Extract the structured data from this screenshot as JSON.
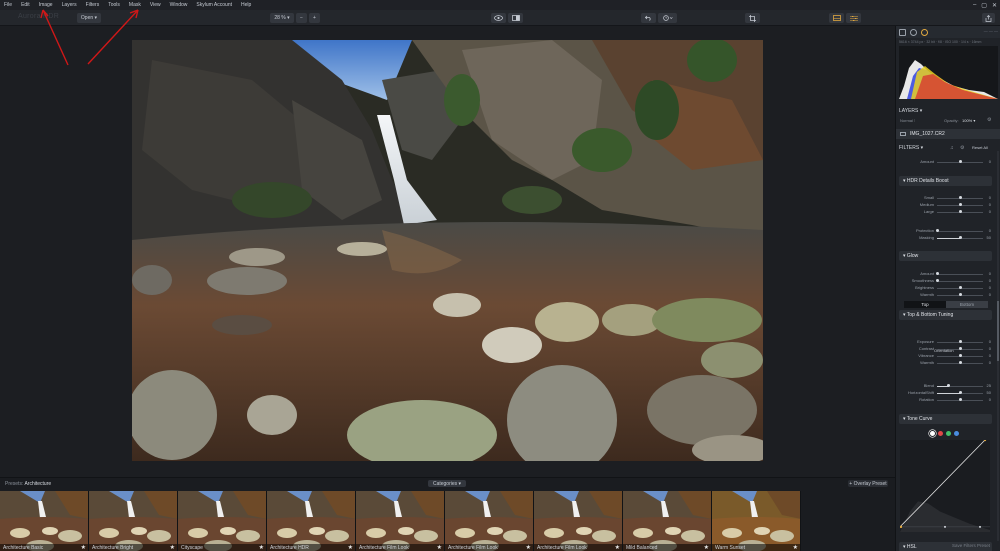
{
  "menu": [
    "File",
    "Edit",
    "Image",
    "Layers",
    "Filters",
    "Tools",
    "Mask",
    "View",
    "Window",
    "Skylum Account",
    "Help"
  ],
  "window_controls": [
    "–",
    "▢",
    "✕"
  ],
  "toolbar": {
    "app_name": "Aurora HDR",
    "open_label": "Open ▾",
    "zoom_label": "28 % ▾",
    "zoom_minus": "−",
    "zoom_plus": "+"
  },
  "panel": {
    "info": "—  —  —",
    "exif": "5616 × 3744 px  ·  32 bit  ·  f/8  ·  ISO 100  ·  1/4 s  ·  16mm",
    "layers": {
      "title": "LAYERS ▾",
      "blend": "Normal ⁝",
      "opacity_label": "Opacity:",
      "opacity_value": "100% ▾",
      "file": "IMG_1027.CR2"
    },
    "filters": {
      "title": "FILTERS ▾",
      "reset": "Reset All",
      "top_amount": {
        "label": "Amount",
        "value": "0",
        "pos": 0.5
      },
      "hdr": {
        "title": "▾ HDR Details Boost",
        "sliders": [
          {
            "label": "Small",
            "value": "0",
            "pos": 0.5
          },
          {
            "label": "Medium",
            "value": "0",
            "pos": 0.5
          },
          {
            "label": "Large",
            "value": "0",
            "pos": 0.5
          },
          {
            "label": "Protection",
            "value": "0",
            "pos": 0.0
          },
          {
            "label": "Masking",
            "value": "50",
            "pos": 0.5
          }
        ]
      },
      "glow": {
        "title": "▾ Glow",
        "sliders": [
          {
            "label": "Amount",
            "value": "0",
            "pos": 0.0
          },
          {
            "label": "Smoothness",
            "value": "0",
            "pos": 0.0
          },
          {
            "label": "Brightness",
            "value": "0",
            "pos": 0.5
          },
          {
            "label": "Warmth",
            "value": "0",
            "pos": 0.5
          }
        ]
      },
      "tbt": {
        "title": "▾ Top & Bottom Tuning",
        "top": "Top",
        "bottom": "Bottom",
        "sliders": [
          {
            "label": "Exposure",
            "value": "0",
            "pos": 0.5
          },
          {
            "label": "Contrast",
            "value": "0",
            "pos": 0.5
          },
          {
            "label": "Vibrance",
            "value": "0",
            "pos": 0.5
          },
          {
            "label": "Warmth",
            "value": "0",
            "pos": 0.5
          }
        ],
        "orientation_title": "Orientation",
        "orientation": [
          {
            "label": "Blend",
            "value": "25",
            "pos": 0.25
          },
          {
            "label": "HorizontalShift",
            "value": "50",
            "pos": 0.5
          },
          {
            "label": "Rotation",
            "value": "0",
            "pos": 0.5
          }
        ]
      },
      "tone_curve": {
        "title": "▾ Tone Curve",
        "channels": [
          "#ffffff",
          "#e04848",
          "#44c06a",
          "#4a8de0"
        ]
      },
      "hsl": {
        "title": "▾ HSL"
      },
      "save_preset": "Save Filters Preset"
    }
  },
  "presets": {
    "label": "Presets:",
    "category": "Architecture",
    "categories_btn": "Categories ▾",
    "overlay_btn": "+ Overlay Preset",
    "items": [
      {
        "name": "Architecture Basic",
        "starred": true
      },
      {
        "name": "Architecture Bright",
        "starred": true
      },
      {
        "name": "Cityscape",
        "starred": true
      },
      {
        "name": "Architecture HDR",
        "starred": true
      },
      {
        "name": "Architecture Film Look",
        "starred": true
      },
      {
        "name": "Architecture Film Look",
        "starred": true
      },
      {
        "name": "Architecture Film Look",
        "starred": true
      },
      {
        "name": "Mild Balanced",
        "starred": true
      },
      {
        "name": "Warm Sunset",
        "starred": true
      }
    ]
  }
}
